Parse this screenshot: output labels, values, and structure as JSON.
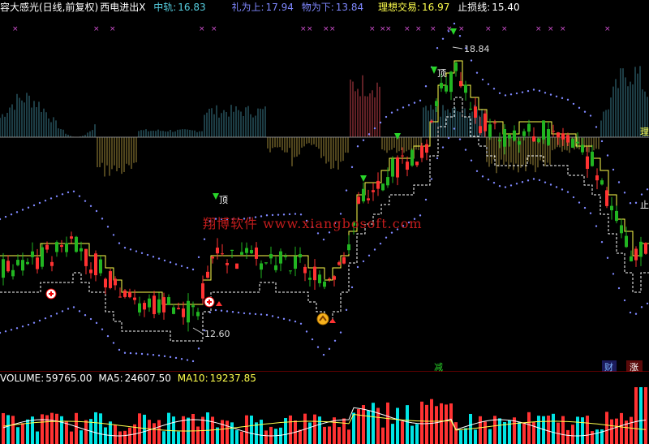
{
  "header": {
    "title": "容大感光(日线,前复权)",
    "indicator": "西电进出X",
    "mid_label": "中轨:",
    "mid_value": "16.83",
    "up_label": "礼为上:",
    "up_value": "17.94",
    "down_label": "物为下:",
    "down_value": "13.84",
    "ideal_label": "理想交易:",
    "ideal_value": "16.97",
    "stop_label": "止损线:",
    "stop_value": "15.40"
  },
  "annotations": {
    "high": "18.84",
    "low": "12.60",
    "ding1": "顶",
    "ding2": "顶",
    "reduce": "减",
    "cai": "财",
    "zhang": "涨",
    "right_li": "理",
    "right_zhi": "止"
  },
  "watermark": "翔博软件 www.xiangbosoft.com",
  "volume": {
    "label": "VOLUME:",
    "value": "59765.00",
    "ma5_label": "MA5:",
    "ma5_value": "24607.50",
    "ma10_label": "MA10:",
    "ma10_value": "19237.85"
  },
  "colors": {
    "up": "#ff3232",
    "down": "#00e4e4",
    "green_candle": "#21b521",
    "band": "#7f88ff",
    "yellow": "#ffff4d",
    "mid": "#56cfe1",
    "gold": "#ffd54a",
    "grey": "#cfcfcf"
  },
  "chart_data": {
    "type": "candlestick",
    "price_range": [
      12.6,
      18.84
    ],
    "volume_latest": 59765.0,
    "volume_ma5": 24607.5,
    "volume_ma10": 19237.85
  }
}
